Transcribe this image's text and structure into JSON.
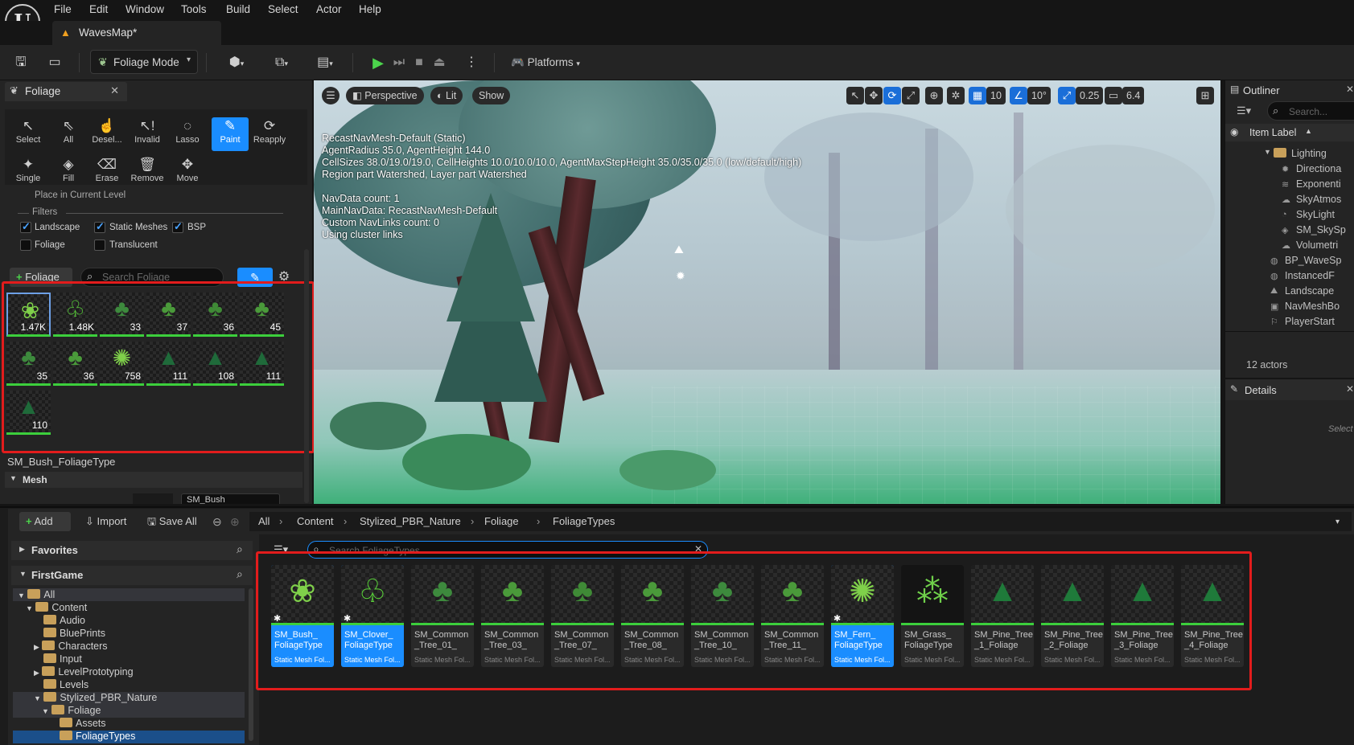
{
  "menu": [
    "File",
    "Edit",
    "Window",
    "Tools",
    "Build",
    "Select",
    "Actor",
    "Help"
  ],
  "map_tab": "WavesMap*",
  "toolbar": {
    "mode": "Foliage Mode",
    "platforms": "Platforms"
  },
  "foliage_panel": {
    "tab": "Foliage",
    "tools_row1": [
      "Select",
      "All",
      "Desel...",
      "Invalid",
      "Lasso",
      "Paint",
      "Reapply"
    ],
    "tools_row2": [
      "Single",
      "Fill",
      "Erase",
      "Remove",
      "Move"
    ],
    "place_current": "Place in Current Level",
    "filters_label": "Filters",
    "filters": [
      {
        "label": "Landscape",
        "checked": true
      },
      {
        "label": "Static Meshes",
        "checked": true
      },
      {
        "label": "BSP",
        "checked": true
      },
      {
        "label": "Foliage",
        "checked": false
      },
      {
        "label": "Translucent",
        "checked": false
      }
    ],
    "add_button": "Foliage",
    "search_placeholder": "Search Foliage",
    "counts": [
      "1.47K",
      "1.48K",
      "33",
      "37",
      "36",
      "45",
      "35",
      "36",
      "758",
      "111",
      "108",
      "111",
      "110"
    ],
    "selected_name": "SM_Bush_FoliageType",
    "mesh_section": "Mesh",
    "mesh_value": "SM_Bush"
  },
  "viewport": {
    "perspective": "Perspective",
    "lit": "Lit",
    "show": "Show",
    "grid": "10",
    "angle": "10°",
    "scale": "0.25",
    "camera_speed": "6.4",
    "nav_info": [
      "RecastNavMesh-Default (Static)",
      "AgentRadius 35.0, AgentHeight 144.0",
      "CellSizes 38.0/19.0/19.0, CellHeights 10.0/10.0/10.0, AgentMaxStepHeight 35.0/35.0/35.0 (low/default/high)",
      "Region part Watershed, Layer part Watershed",
      "",
      "NavData count: 1",
      "MainNavData: RecastNavMesh-Default",
      "Custom NavLinks count: 0",
      "Using cluster links"
    ]
  },
  "outliner": {
    "title": "Outliner",
    "search_placeholder": "Search...",
    "column": "Item Label",
    "items": [
      "Lighting",
      "Directiona",
      "Exponenti",
      "SkyAtmos",
      "SkyLight",
      "SM_SkySp",
      "Volumetri",
      "BP_WaveSp",
      "InstancedF",
      "Landscape",
      "NavMeshBo",
      "PlayerStart"
    ],
    "count": "12 actors"
  },
  "details": {
    "title": "Details",
    "hint": "Select"
  },
  "content_browser": {
    "add": "Add",
    "import": "Import",
    "save_all": "Save All",
    "breadcrumb": [
      "All",
      "Content",
      "Stylized_PBR_Nature",
      "Foliage",
      "FoliageTypes"
    ],
    "favorites": "Favorites",
    "project": "FirstGame",
    "search_placeholder": "Search FoliageTypes",
    "tree": [
      "All",
      "Content",
      "Audio",
      "BluePrints",
      "Characters",
      "Input",
      "LevelPrototyping",
      "Levels",
      "Stylized_PBR_Nature",
      "Foliage",
      "Assets",
      "FoliageTypes"
    ],
    "assets": [
      {
        "name": "SM_Bush_ FoliageType",
        "type": "Static Mesh Fol...",
        "selected": true
      },
      {
        "name": "SM_Clover_ FoliageType",
        "type": "Static Mesh Fol...",
        "selected": true
      },
      {
        "name": "SM_Common _Tree_01_",
        "type": "Static Mesh Fol...",
        "selected": false
      },
      {
        "name": "SM_Common _Tree_03_",
        "type": "Static Mesh Fol...",
        "selected": false
      },
      {
        "name": "SM_Common _Tree_07_",
        "type": "Static Mesh Fol...",
        "selected": false
      },
      {
        "name": "SM_Common _Tree_08_",
        "type": "Static Mesh Fol...",
        "selected": false
      },
      {
        "name": "SM_Common _Tree_10_",
        "type": "Static Mesh Fol...",
        "selected": false
      },
      {
        "name": "SM_Common _Tree_11_",
        "type": "Static Mesh Fol...",
        "selected": false
      },
      {
        "name": "SM_Fern_ FoliageType",
        "type": "Static Mesh Fol...",
        "selected": true
      },
      {
        "name": "SM_Grass_ FoliageType",
        "type": "Static Mesh Fol...",
        "selected": false
      },
      {
        "name": "SM_Pine_Tree _1_Foliage",
        "type": "Static Mesh Fol...",
        "selected": false
      },
      {
        "name": "SM_Pine_Tree _2_Foliage",
        "type": "Static Mesh Fol...",
        "selected": false
      },
      {
        "name": "SM_Pine_Tree _3_Foliage",
        "type": "Static Mesh Fol...",
        "selected": false
      },
      {
        "name": "SM_Pine_Tree _4_Foliage",
        "type": "Static Mesh Fol...",
        "selected": false
      }
    ]
  }
}
